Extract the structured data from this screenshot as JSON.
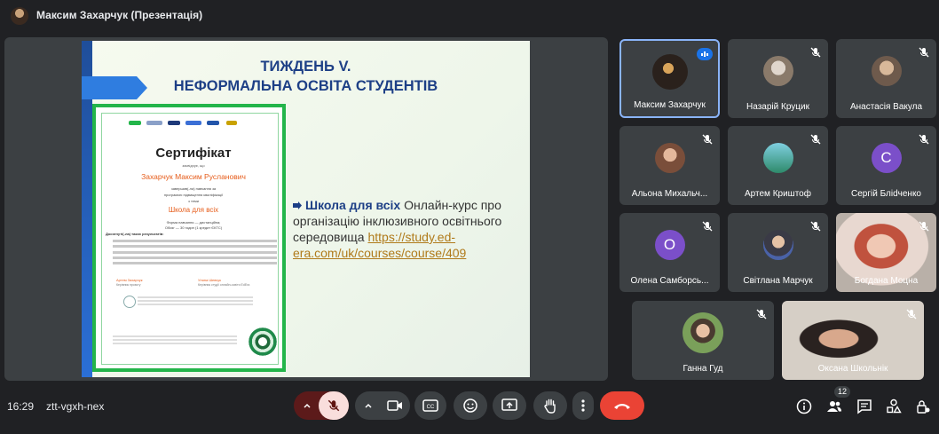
{
  "header": {
    "presenter_title": "Максим Захарчук (Презентація)"
  },
  "slide": {
    "title_line1": "ТИЖДЕНЬ V.",
    "title_line2": "НЕФОРМАЛЬНА ОСВІТА СТУДЕНТІВ",
    "heading": "Школа для всіх",
    "text": " Онлайн-курс про організацію інклюзивного освітнього середовища ",
    "link": "https://study.ed-era.com/uk/courses/course/409",
    "certificate": {
      "title": "Сертифікат",
      "attest": "засвідчує, що",
      "name": "Захарчук Максим Русланович",
      "line1": "завершив(-ла) навчання за",
      "line2": "програмою підвищення кваліфікації",
      "line3": "з теми",
      "course": "Школа для всіх",
      "form1": "Форма навчання — дистанційна;",
      "form2": "Обсяг — 30 годин (1 кредит ЄКТС)",
      "results": "Досягнуті(-ла) таких результатів:",
      "sig_left": "Артем Захарчук",
      "sig_left_role": "Керівник проєкту",
      "sig_right": "Уляна Шевчук",
      "sig_right_role": "Керівник студії онлайн-освіти EdEra"
    }
  },
  "participants": [
    {
      "name": "Максим Захарчук"
    },
    {
      "name": "Назарій Круцик"
    },
    {
      "name": "Анастасія Вакула"
    },
    {
      "name": "Альона Михальч..."
    },
    {
      "name": "Артем Криштоф"
    },
    {
      "name": "Сергій Бліdченко",
      "letter": "С",
      "color": "#7b4fc9"
    },
    {
      "name": "Олена Самборсь...",
      "letter": "О",
      "color": "#7b4fc9"
    },
    {
      "name": "Світлана Марчук"
    },
    {
      "name": "Богдана Моцна"
    },
    {
      "name": "Ганна Гуд"
    },
    {
      "name": "Оксана Школьнік"
    }
  ],
  "footer": {
    "time": "16:29",
    "meeting_code": "ztt-vgxh-nex",
    "people_count": "12"
  },
  "colors": {
    "background": "#202124",
    "tile": "#3c4043",
    "mic_off": "#f9dedc",
    "end_call": "#ea4335",
    "speaking": "#1a73e8"
  }
}
